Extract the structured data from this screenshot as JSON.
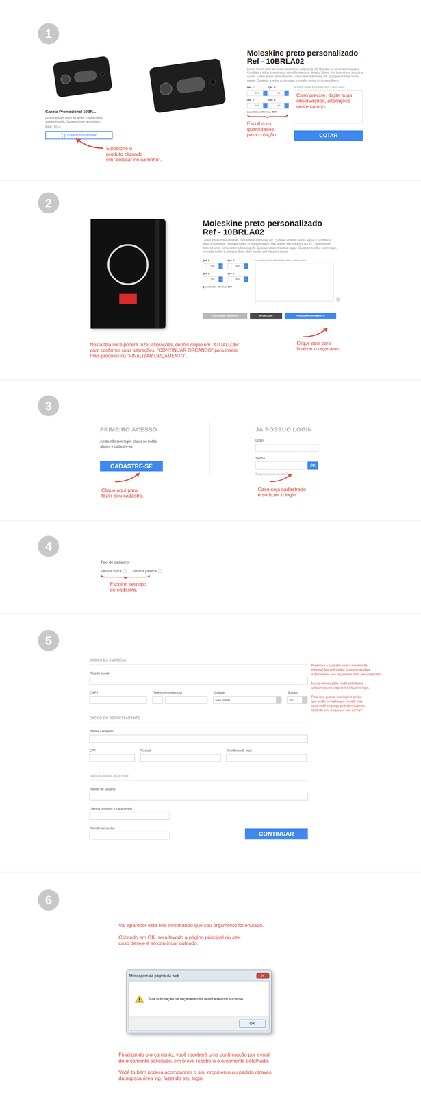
{
  "step1": {
    "number": "1",
    "card": {
      "title": "Caneta Promocional 10BR...",
      "description": "Lorem ipsum dolor sit amet, consectetur adipiscing elit. Suspendisse a mi diam.",
      "ref": "REF: 2014",
      "button": "colocar no carrinho"
    },
    "card_annotation": [
      "Selecione o",
      "produto clicando",
      "em \"colocar no carrinho\"."
    ],
    "product": {
      "title": [
        "Moleskine preto personalizado",
        "Ref - 10BRLA02"
      ],
      "description": "Lorem ipsum dolor sit amet, consectetur adipiscing elit. Quisque vit amet lacinia augue. Curabitur a tellus scelerisque, convallis metus in, tempus libero. Sed laoreet sed mauris a auctor. Lorem ipsum dolor sit amet, consectetur adipiscing elit. Quisque vit amet lacinia augue. Curabitur a tellus scelerisque, convallis metus in, tempus libero.",
      "quantities": [
        {
          "label": "Qtd. 1:",
          "value": "500"
        },
        {
          "label": "Qtd. 1:",
          "value": "500"
        },
        {
          "label": "Qtd. 1:",
          "value": "500"
        },
        {
          "label": "Qtd. 1:",
          "value": "500"
        }
      ],
      "minimum": "Quantidade Mínima: 500",
      "notes_label": "Se desejar maiores informações, utilize o campo abaixo",
      "notes_hint": "Caso precise, digite suas observações, alterações neste campo.",
      "submit": "COTAR"
    },
    "quantities_annotation": [
      "Escolha as",
      "quantidades",
      "para cotação."
    ]
  },
  "step2": {
    "number": "2",
    "product": {
      "title": [
        "Moleskine preto personalizado",
        "Ref - 10BRLA02"
      ],
      "description": "Lorem ipsum dolor sit amet, consectetur adipiscing elit. Quisque vit amet lacinia augue. Curabitur a tellus scelerisque, convallis metus in, tempus libero. Sed laoreet sed mauris a auctor. Lorem ipsum dolor sit amet, consectetur adipiscing elit. Quisque vit amet lacinia augue. Curabitur a tellus scelerisque, convallis metus in, tempus libero. Sed laoreet sed mauris a auctor.",
      "quantities": [
        {
          "label": "Qtd. 1:",
          "value": "500"
        },
        {
          "label": "Qtd. 1:",
          "value": "500"
        },
        {
          "label": "Qtd. 1:",
          "value": "500"
        },
        {
          "label": "Qtd. 1:",
          "value": "500"
        }
      ],
      "minimum": "Quantidade Mínima: 500",
      "notes_label": "Se desejar maiores informações, utilize o campo abaixo"
    },
    "buttons": [
      {
        "label": "CONTINUAR ORÇANDO",
        "kind": "secondary"
      },
      {
        "label": "ATUALIZAR",
        "kind": "dark"
      },
      {
        "label": "FINALIZAR ORÇAMENTO",
        "kind": "primary"
      }
    ],
    "annotation": [
      "Nesta tela você poderá fazer alterações, depois clique  em \"ATUALIZAR\"",
      "para confirmar suas alterações, \"CONTINUAR ORÇANDO\" para inserir",
      "mais produtos ou \"FINALIZAR ORÇAMENTO\"."
    ],
    "finish_annotation": [
      "Clique aqui para",
      "finalizar o orçamento"
    ]
  },
  "step3": {
    "number": "3",
    "first_access": {
      "heading": "PRIMEIRO ACESSO",
      "text": [
        "Ainda não tem login, clique no botão",
        "abaixo e cadastre-se."
      ],
      "button": "CADASTRE-SE",
      "annotation": [
        "Clique aqui para",
        "fazer seu cadastro."
      ]
    },
    "login": {
      "heading": "JÁ POSSUO LOGIN",
      "login_label": "Login",
      "password_label": "Senha",
      "button": "OK",
      "forgot": "Esqueceu sua senha?",
      "annotation": [
        "Caso seja cadastrado",
        "é só fazer o login."
      ]
    }
  },
  "step4": {
    "number": "4",
    "label": "Tipo de cadastro:",
    "options": [
      {
        "label": "Pessoa física",
        "checked": false
      },
      {
        "label": "Pessoa jurídica",
        "checked": false
      }
    ],
    "annotation": [
      "Escolha seu tipo",
      "de cadastro."
    ]
  },
  "step5": {
    "number": "5",
    "groups": [
      {
        "heading": "DADOS DA EMPRESA",
        "rows": [
          [
            {
              "label": "*Razão social",
              "kind": "full",
              "value": ""
            }
          ],
          [
            {
              "label": "CNPJ",
              "kind": "cnpj",
              "value": ""
            },
            {
              "label": "*Telefone residencial",
              "kind": "phone",
              "value": ""
            },
            {
              "label": "*Cidade",
              "kind": "city",
              "value": "São Paulo"
            },
            {
              "label": "*Estado",
              "kind": "state",
              "value": "SP"
            }
          ]
        ]
      },
      {
        "heading": "DADOS DO REPRESENTANTE",
        "rows": [
          [
            {
              "label": "*Nome completo",
              "kind": "full",
              "value": ""
            }
          ],
          [
            {
              "label": "CPF",
              "kind": "cpf",
              "value": ""
            },
            {
              "label": "*E-mail",
              "kind": "email",
              "value": ""
            },
            {
              "label": "*Confirmar E-mail",
              "kind": "email",
              "value": ""
            }
          ]
        ]
      },
      {
        "heading": "DADOS PARA ACESSO",
        "rows": [
          [
            {
              "label": "*Nome de usuário",
              "kind": "full",
              "value": ""
            }
          ],
          [
            {
              "label": "*Senha (mínimo 8 caracteres)",
              "kind": "password",
              "value": ""
            }
          ],
          [
            {
              "label": "*Confirmar senha",
              "kind": "password",
              "value": ""
            }
          ]
        ]
      }
    ],
    "submit": "CONTINUAR",
    "notes": [
      [
        "Preencha o cadastro com o máximo de",
        "informações solicitadas, isso nos ajudara",
        "a desvarmos seu orçamento mais personalizado"
      ],
      [
        "Essas informações serão solicitadas",
        "uma única vez, depois é só fazer o login."
      ],
      [
        "Para isso guarde seu login e senha",
        "que serão enviadas por e-mail, mas",
        "caso você esqueça poderá recuperar,",
        "clicando em: Esqueceu sua senha?"
      ]
    ]
  },
  "step6": {
    "number": "6",
    "intro": [
      [
        "Vai aparecer esta tela informando que seu orçamento foi enviado."
      ],
      [
        "Clicando em OK, será levado a página principal do site,",
        "caso deseje é só continuar cotando."
      ]
    ],
    "dialog": {
      "title": "Mensagem da página da web",
      "message": "Sua solicitação de orçamento foi realizada com sucesso",
      "button": "OK"
    },
    "outro": [
      [
        "Finalizando o orçamento, você receberá uma confirmação por e-mail",
        "do orçamento solicitado, em breve receberá o orçamento detalhado."
      ],
      [
        "Você ta,bém poderá acompanhar o seu orçamento ou pedido através",
        "da nopssa área vip, fazendo seu login."
      ]
    ]
  }
}
